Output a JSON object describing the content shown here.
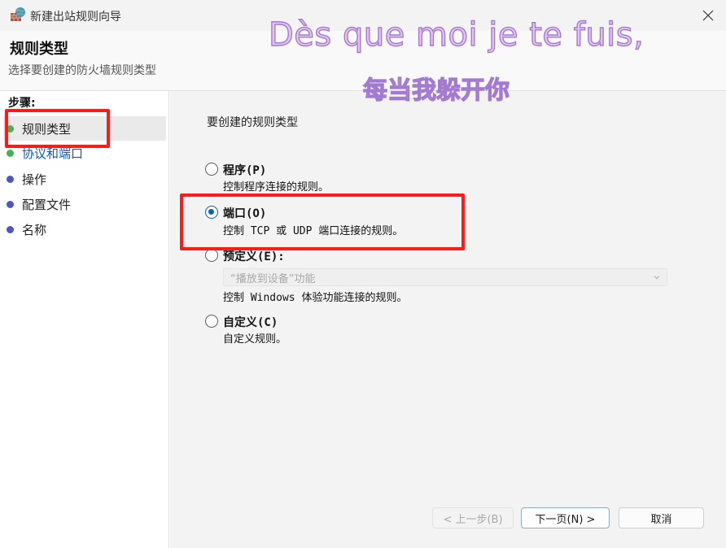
{
  "window": {
    "title": "新建出站规则向导",
    "close_icon": "close-icon"
  },
  "header": {
    "title": "规则类型",
    "subtitle": "选择要创建的防火墙规则类型"
  },
  "overlay": {
    "line1": "Dès que moi je te fuis,",
    "line2": "每当我躲开你"
  },
  "sidebar": {
    "steps_label": "步骤:",
    "items": [
      {
        "label": "规则类型",
        "bullet_color": "#4caf50",
        "current": true
      },
      {
        "label": "协议和端口",
        "bullet_color": "#4caf50",
        "link": true
      },
      {
        "label": "操作",
        "bullet_color": "#4b55c4"
      },
      {
        "label": "配置文件",
        "bullet_color": "#4b55c4"
      },
      {
        "label": "名称",
        "bullet_color": "#4b55c4"
      }
    ]
  },
  "main": {
    "heading": "要创建的规则类型",
    "options": [
      {
        "label": "程序(P)",
        "desc": "控制程序连接的规则。",
        "checked": false
      },
      {
        "label": "端口(O)",
        "desc": "控制 TCP 或 UDP 端口连接的规则。",
        "checked": true
      },
      {
        "label": "预定义(E):",
        "desc": "控制 Windows 体验功能连接的规则。",
        "checked": false,
        "combo_value": "“播放到设备”功能"
      },
      {
        "label": "自定义(C)",
        "desc": "自定义规则。",
        "checked": false
      }
    ]
  },
  "footer": {
    "back_label": "< 上一步(B)",
    "next_label": "下一页(N) >",
    "cancel_label": "取消"
  },
  "colors": {
    "accent": "#0a5fb8",
    "highlight": "#ff1a1a"
  }
}
